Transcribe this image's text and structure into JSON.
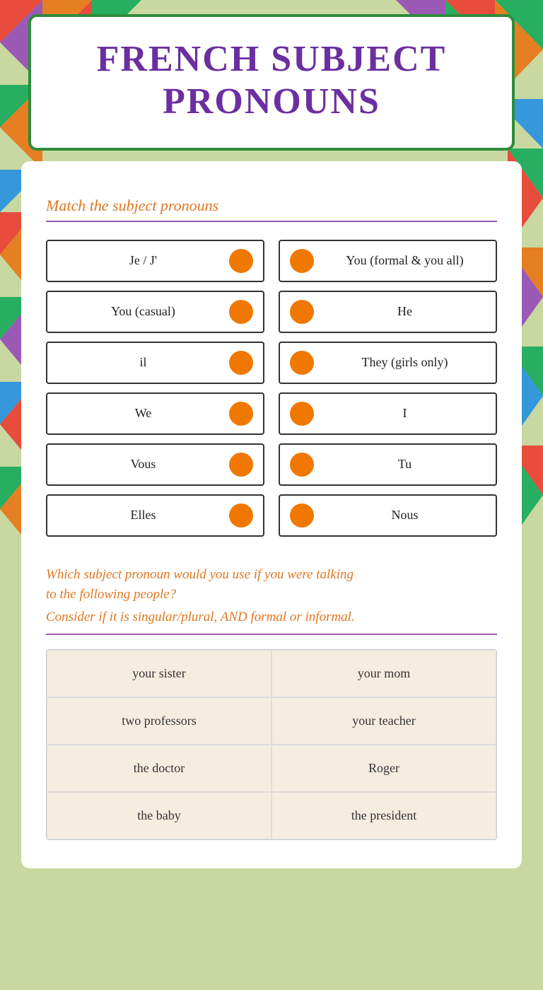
{
  "page": {
    "title_line1": "FRENCH SUBJECT",
    "title_line2": "PRONOUNS"
  },
  "section1": {
    "heading": "Match the subject pronouns"
  },
  "match_rows": [
    {
      "left": "Je / J'",
      "right": "You (formal & you all)"
    },
    {
      "left": "You (casual)",
      "right": "He"
    },
    {
      "left": "il",
      "right": "They (girls only)"
    },
    {
      "left": "We",
      "right": "I"
    },
    {
      "left": "Vous",
      "right": "Tu"
    },
    {
      "left": "Elles",
      "right": "Nous"
    }
  ],
  "section2": {
    "question_line1": "Which subject pronoun would you use if you were talking",
    "question_line2": "to the following people?",
    "sub_text": "Consider if it is singular/plural, AND formal or informal."
  },
  "answer_rows": [
    {
      "left": "your sister",
      "right": "your mom"
    },
    {
      "left": "two professors",
      "right": "your teacher"
    },
    {
      "left": "the doctor",
      "right": "Roger"
    },
    {
      "left": "the baby",
      "right": "the president"
    }
  ]
}
